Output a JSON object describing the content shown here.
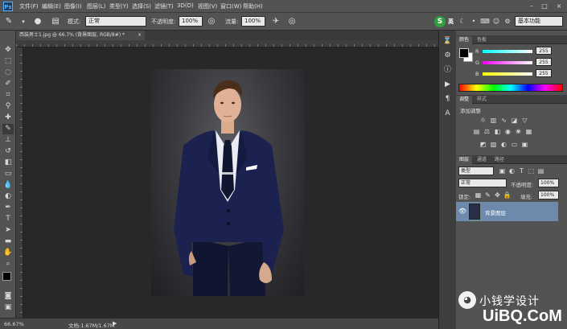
{
  "app": {
    "logo_text": "Ps"
  },
  "menu": {
    "items": [
      "文件(F)",
      "编辑(E)",
      "图像(I)",
      "图层(L)",
      "类型(Y)",
      "选择(S)",
      "滤镜(T)",
      "3D(D)",
      "视图(V)",
      "窗口(W)",
      "帮助(H)"
    ]
  },
  "options": {
    "mode_label": "模式:",
    "mode_value": "正常",
    "opacity_label": "不透明度:",
    "opacity_value": "100%",
    "flow_label": "流量:",
    "flow_value": "100%",
    "workspace_value": "基本功能",
    "ime_label": "英"
  },
  "document": {
    "tab_title": "西装男士1.jpg @ 66.7% (背景图层, RGB/8#) *"
  },
  "status": {
    "zoom": "66.67%",
    "doc_info": "文档:1.67M/1.67M"
  },
  "color_panel": {
    "tabs": [
      "颜色",
      "色板"
    ],
    "channels": [
      {
        "label": "R",
        "value": "255"
      },
      {
        "label": "G",
        "value": "255"
      },
      {
        "label": "B",
        "value": "255"
      }
    ]
  },
  "adjust_panel": {
    "tabs": [
      "调整",
      "样式"
    ],
    "title": "添加调整"
  },
  "layers_panel": {
    "tabs": [
      "图层",
      "通道",
      "路径"
    ],
    "filter_value": "类型",
    "blend_value": "正常",
    "opacity_label": "不透明度:",
    "opacity_value": "100%",
    "lock_label": "锁定:",
    "fill_label": "填充:",
    "fill_value": "100%",
    "layer_name": "背景图层"
  },
  "watermark": {
    "text": "小钱学设计",
    "site": "UiBQ.CoM"
  },
  "colors": {
    "accent": "#6d8aad",
    "panel": "#535353",
    "canvas": "#282828"
  }
}
